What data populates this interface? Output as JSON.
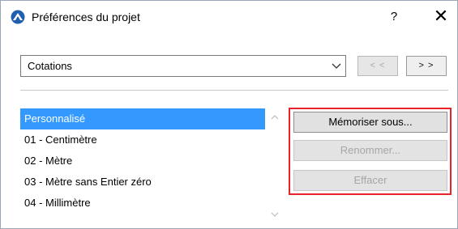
{
  "window": {
    "title": "Préférences du projet",
    "help_label": "?",
    "close_label": "✕"
  },
  "category_select": {
    "selected": "Cotations"
  },
  "navigation": {
    "prev_label": "< <",
    "next_label": "> >"
  },
  "presets": {
    "items": [
      {
        "label": "Personnalisé",
        "selected": true
      },
      {
        "label": "01 - Centimètre",
        "selected": false
      },
      {
        "label": "02 - Mètre",
        "selected": false
      },
      {
        "label": "03 - Mètre sans Entier zéro",
        "selected": false
      },
      {
        "label": "04 - Millimètre",
        "selected": false
      }
    ]
  },
  "actions": {
    "save_as_label": "Mémoriser sous...",
    "rename_label": "Renommer...",
    "delete_label": "Effacer"
  },
  "colors": {
    "selection": "#3399ff",
    "highlight_border": "#e8232a",
    "disabled_text": "#a6a6a6"
  }
}
